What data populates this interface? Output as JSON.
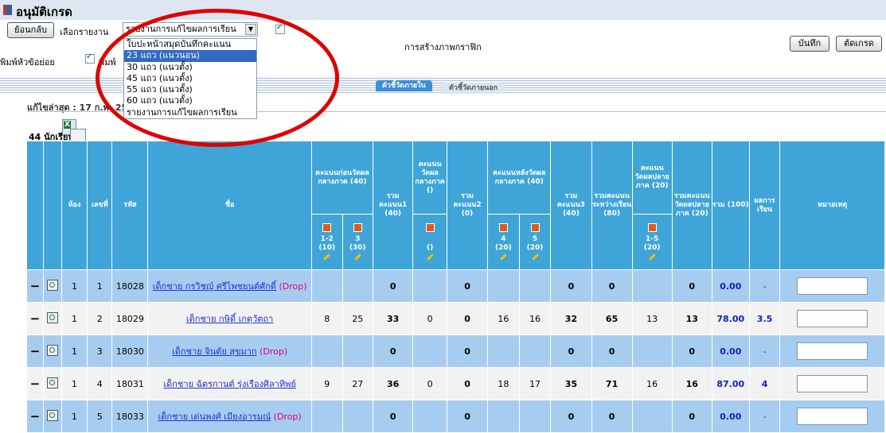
{
  "window": {
    "title": "อนุมัติเกรด"
  },
  "toolbar": {
    "back_label": "ย้อนกลับ",
    "report_label": "เลือกรายงาน",
    "report_selected": "รายงานการแก้ไขผลการเรียน",
    "graphic_label": "การสร้างภาพกราฟิก",
    "save_label": "บันทึก",
    "grade_label": "ตัดเกรด",
    "print_header_label": "พิมพ์หัวข้อย่อย",
    "print_label": "พิมพ์"
  },
  "dropdown": {
    "options": [
      "ใบปะหน้าสมุดบันทึกคะแนน",
      "23 แถว (แนวนอน)",
      "30 แถว (แนวตั้ง)",
      "45 แถว (แนวตั้ง)",
      "55 แถว (แนวตั้ง)",
      "60 แถว (แนวตั้ง)",
      "รายงานการแก้ไขผลการเรียน"
    ],
    "selected_index": 1
  },
  "tabs": [
    {
      "label": "ตัวชี้วัดภายใน"
    },
    {
      "label": "ตัวชี้วัดภายนอก"
    }
  ],
  "info": {
    "last_edit": "แก้ไขล่าสุด : 17 ก.พ. 255",
    "count": "44 นักเรียน"
  },
  "table": {
    "headers": {
      "room": "ห้อง",
      "no": "เลขที่",
      "id": "รหัส",
      "name": "ชื่อ",
      "pre_mid": "คะแนนก่อนวัดผลกลางภาค (40)",
      "sum1": "รวมคะแนน1 (40)",
      "mid": "คะแนนวัดผลกลางภาค ()",
      "sum2": "รวมคะแนน2 (0)",
      "post_mid": "คะแนนหลังวัดผลกลางภาค (40)",
      "sum3": "รวมคะแนน3 (40)",
      "sum_term": "รวมคะแนนระหว่างเรียน (80)",
      "final": "คะแนนวัดผลปลายภาค (20)",
      "sum_final": "รวมคะแนนวัดผลปลายภาค (20)",
      "total": "รวม (100)",
      "grade": "ผลการเรียน",
      "note": "หมายเหตุ"
    },
    "subheaders": {
      "c1": "1-2",
      "c1w": "(10)",
      "c2": "3",
      "c2w": "(30)",
      "c3w": "()",
      "c4": "4",
      "c4w": "(20)",
      "c5": "5",
      "c5w": "(20)",
      "c6": "1-5",
      "c6w": "(20)"
    },
    "rows": [
      {
        "minus": "−",
        "room": "1",
        "no": "1",
        "id": "18028",
        "name": "เด็กชาย กรวิชญ์ ศรีไพชยนต์ศักดิ์",
        "drop": "(Drop)",
        "s1": "",
        "s2": "",
        "sum1": "0",
        "mid": "",
        "sum2": "0",
        "s4": "",
        "s5": "",
        "sum3": "0",
        "sum_term": "0",
        "final": "",
        "sum_final": "0",
        "total": "0.00",
        "grade": "-"
      },
      {
        "minus": "−",
        "room": "1",
        "no": "2",
        "id": "18029",
        "name": "เด็กชาย กษิดิ์ เกตุวัตถา",
        "drop": "",
        "s1": "8",
        "s2": "25",
        "sum1": "33",
        "mid": "0",
        "sum2": "0",
        "s4": "16",
        "s5": "16",
        "sum3": "32",
        "sum_term": "65",
        "final": "13",
        "sum_final": "13",
        "total": "78.00",
        "grade": "3.5"
      },
      {
        "minus": "−",
        "room": "1",
        "no": "3",
        "id": "18030",
        "name": "เด็กชาย จินตัย สุขมาก",
        "drop": "(Drop)",
        "s1": "",
        "s2": "",
        "sum1": "0",
        "mid": "",
        "sum2": "0",
        "s4": "",
        "s5": "",
        "sum3": "0",
        "sum_term": "0",
        "final": "",
        "sum_final": "0",
        "total": "0.00",
        "grade": "-"
      },
      {
        "minus": "−",
        "room": "1",
        "no": "4",
        "id": "18031",
        "name": "เด็กชาย ฉัตรกานต์ รุ่งเรืองศิลาทิพย์",
        "drop": "",
        "s1": "9",
        "s2": "27",
        "sum1": "36",
        "mid": "0",
        "sum2": "0",
        "s4": "18",
        "s5": "17",
        "sum3": "35",
        "sum_term": "71",
        "final": "16",
        "sum_final": "16",
        "total": "87.00",
        "grade": "4"
      },
      {
        "minus": "−",
        "room": "1",
        "no": "5",
        "id": "18033",
        "name": "เด็กชาย เด่นพงศ์ เมียงอารมณ์",
        "drop": "(Drop)",
        "s1": "",
        "s2": "",
        "sum1": "0",
        "mid": "",
        "sum2": "0",
        "s4": "",
        "s5": "",
        "sum3": "0",
        "sum_term": "0",
        "final": "",
        "sum_final": "0",
        "total": "0.00",
        "grade": "-"
      }
    ]
  },
  "colors": {
    "header_blue": "#3fa5d8",
    "row_blue": "#a6cdf0",
    "row_white": "#f2f2f2",
    "highlight_circle": "#e00000"
  }
}
